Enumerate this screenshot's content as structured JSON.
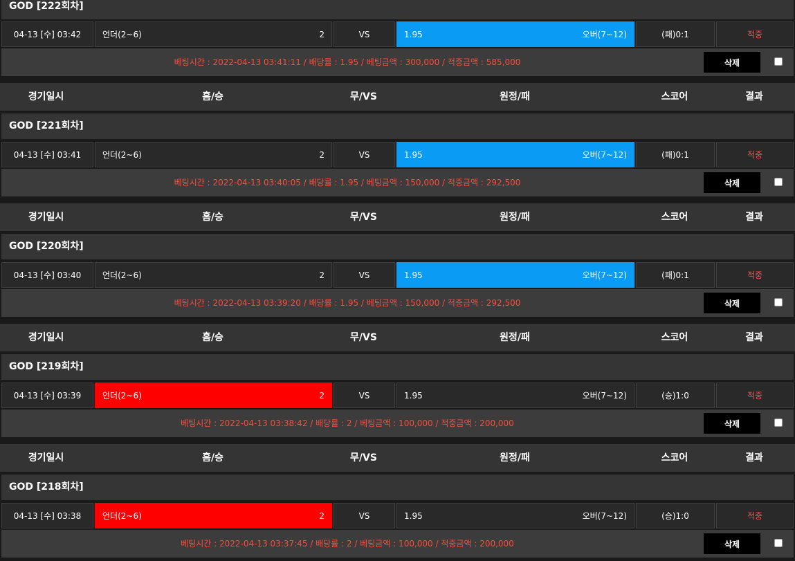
{
  "columns": {
    "date": "경기일시",
    "home": "홈/승",
    "draw": "무/VS",
    "away": "원정/패",
    "score": "스코어",
    "result": "결과"
  },
  "delete_label": "삭제",
  "colors": {
    "selected_blue": "#0a9bf5",
    "selected_red": "#ff0000",
    "result_text": "#ff4d4d",
    "info_text": "#ff4a3a"
  },
  "rounds": [
    {
      "title": "GOD [222회차]",
      "date": "04-13 [수] 03:42",
      "home_team": "언더(2~6)",
      "home_odds": "2",
      "vs": "VS",
      "away_odds": "1.95",
      "away_team": "오버(7~12)",
      "selected": "away",
      "score": "(패)0:1",
      "result": "적중",
      "info": "베팅시간 : 2022-04-13 03:41:11  /  배당률 : 1.95  /  베팅금액 : 300,000  /  적중금액 : 585,000"
    },
    {
      "title": "GOD [221회차]",
      "date": "04-13 [수] 03:41",
      "home_team": "언더(2~6)",
      "home_odds": "2",
      "vs": "VS",
      "away_odds": "1.95",
      "away_team": "오버(7~12)",
      "selected": "away",
      "score": "(패)0:1",
      "result": "적중",
      "info": "베팅시간 : 2022-04-13 03:40:05  /  배당률 : 1.95  /  베팅금액 : 150,000  /  적중금액 : 292,500"
    },
    {
      "title": "GOD [220회차]",
      "date": "04-13 [수] 03:40",
      "home_team": "언더(2~6)",
      "home_odds": "2",
      "vs": "VS",
      "away_odds": "1.95",
      "away_team": "오버(7~12)",
      "selected": "away",
      "score": "(패)0:1",
      "result": "적중",
      "info": "베팅시간 : 2022-04-13 03:39:20  /  배당률 : 1.95  /  베팅금액 : 150,000  /  적중금액 : 292,500"
    },
    {
      "title": "GOD [219회차]",
      "date": "04-13 [수] 03:39",
      "home_team": "언더(2~6)",
      "home_odds": "2",
      "vs": "VS",
      "away_odds": "1.95",
      "away_team": "오버(7~12)",
      "selected": "home",
      "score": "(승)1:0",
      "result": "적중",
      "info": "베팅시간 : 2022-04-13 03:38:42  /  배당률 : 2  /  베팅금액 : 100,000  /  적중금액 : 200,000"
    },
    {
      "title": "GOD [218회차]",
      "date": "04-13 [수] 03:38",
      "home_team": "언더(2~6)",
      "home_odds": "2",
      "vs": "VS",
      "away_odds": "1.95",
      "away_team": "오버(7~12)",
      "selected": "home",
      "score": "(승)1:0",
      "result": "적중",
      "info": "베팅시간 : 2022-04-13 03:37:45  /  배당률 : 2  /  베팅금액 : 100,000  /  적중금액 : 200,000"
    }
  ]
}
